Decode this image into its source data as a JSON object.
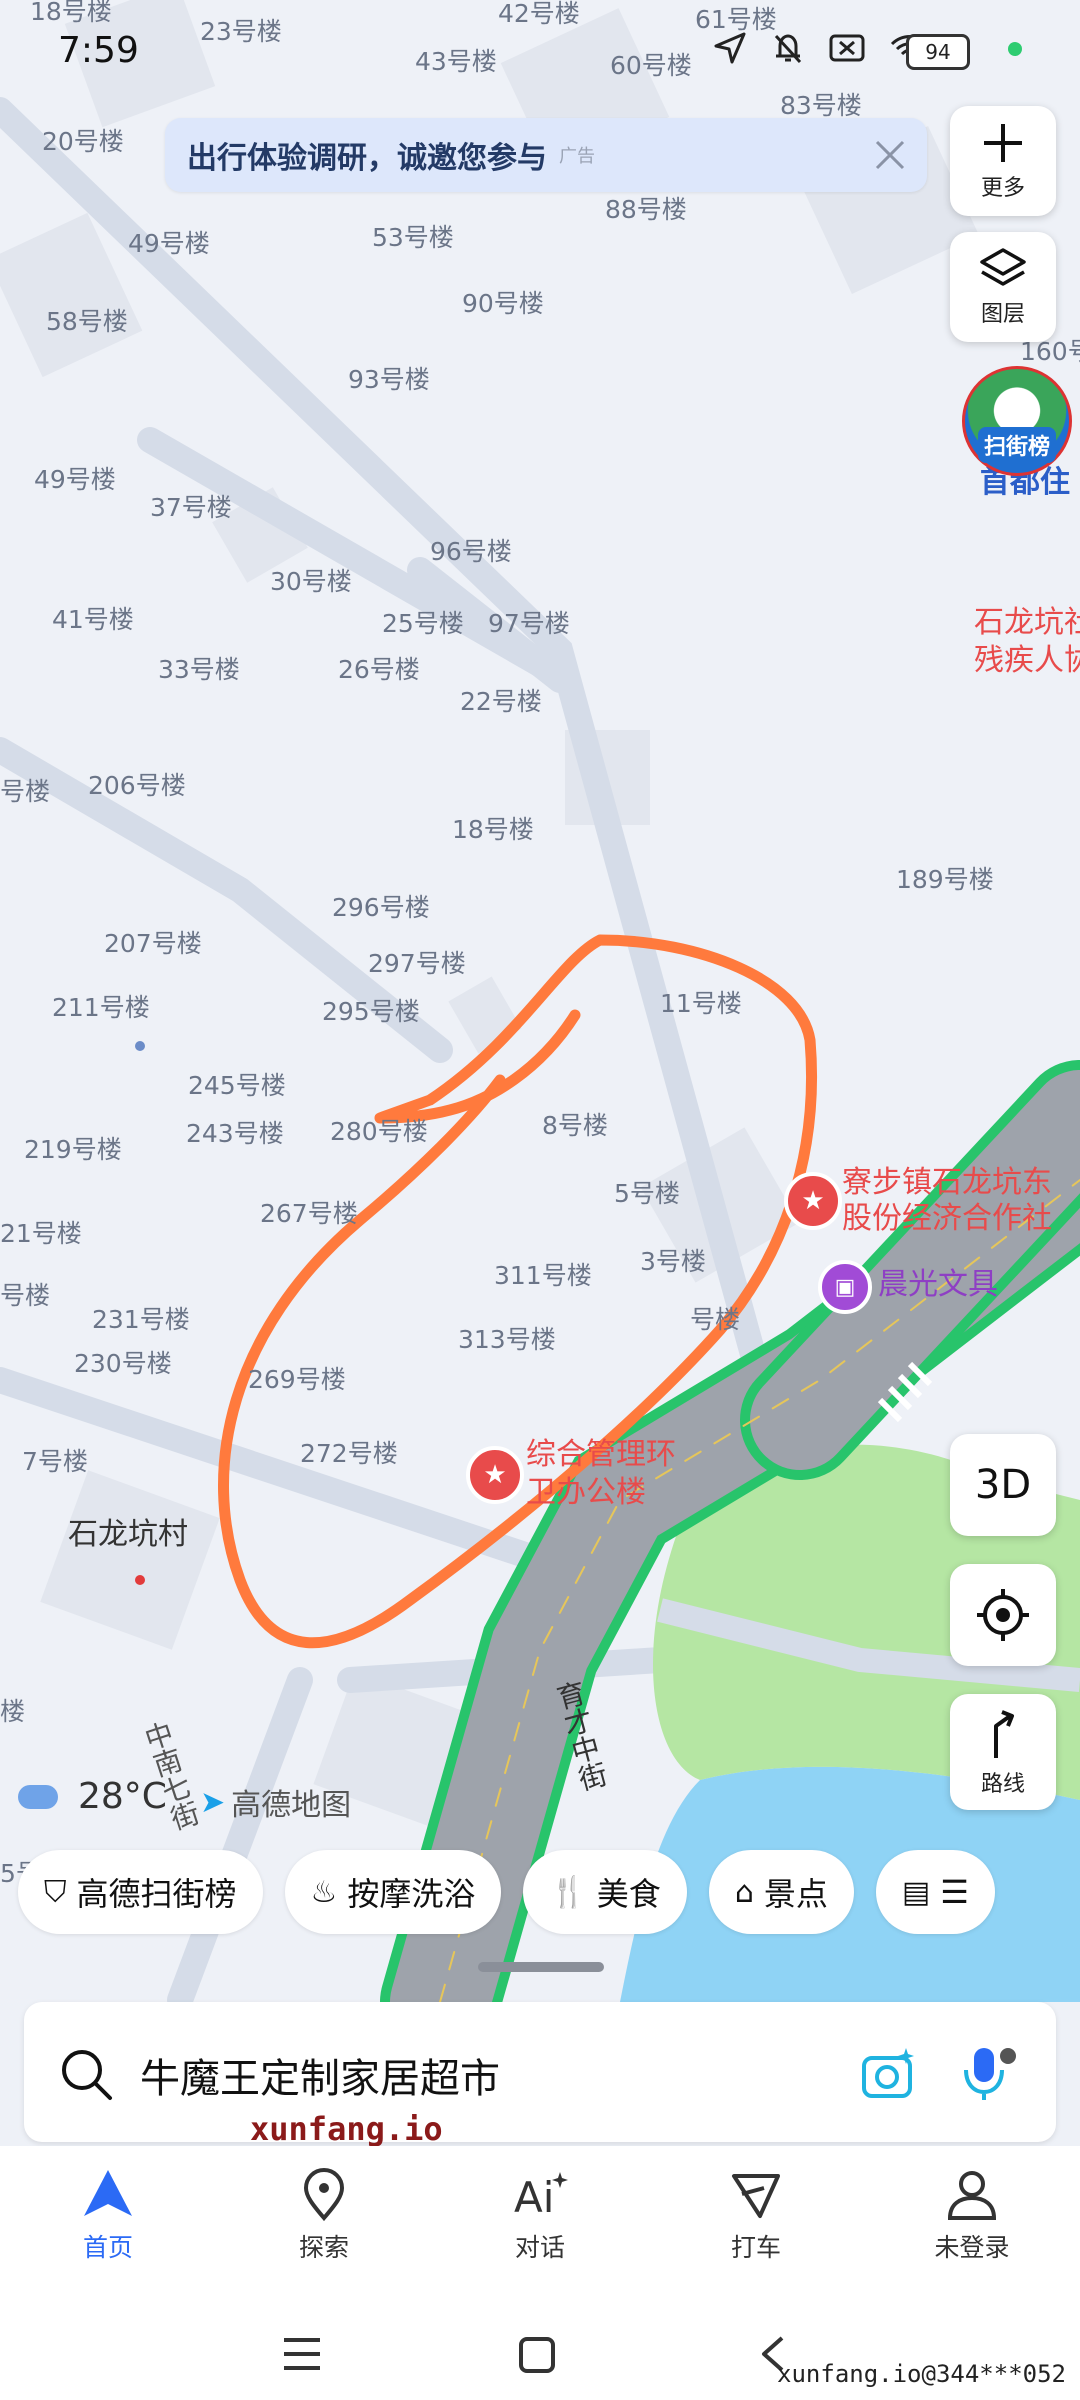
{
  "status_bar": {
    "time": "7:59",
    "battery": "94"
  },
  "banner": {
    "text": "出行体验调研，诚邀您参与",
    "ad_label": "广告"
  },
  "right_controls": {
    "more_label": "更多",
    "layers_label": "图层",
    "scan_badge": "扫街榜",
    "three_d": "3D",
    "route_label": "路线"
  },
  "map": {
    "building_labels": [
      "18号楼",
      "23号楼",
      "42号楼",
      "61号楼",
      "43号楼",
      "60号楼",
      "83号楼",
      "20号楼",
      "88号楼",
      "49号楼",
      "53号楼",
      "58号楼",
      "90号楼",
      "93号楼",
      "160号",
      "49号楼",
      "37号楼",
      "96号楼",
      "30号楼",
      "41号楼",
      "25号楼",
      "97号楼",
      "33号楼",
      "26号楼",
      "22号楼",
      "号楼",
      "206号楼",
      "18号楼",
      "189号楼",
      "296号楼",
      "207号楼",
      "297号楼",
      "211号楼",
      "295号楼",
      "11号楼",
      "245号楼",
      "243号楼",
      "280号楼",
      "8号楼",
      "219号楼",
      "267号楼",
      "5号楼",
      "21号楼",
      "3号楼",
      "311号楼",
      "号楼",
      "231号楼",
      "号楼",
      "313号楼",
      "230号楼",
      "269号楼",
      "272号楼",
      "7号楼",
      "楼",
      "5号"
    ],
    "road_labels": {
      "yucai": "育才中街",
      "zhongnan": "中南七街"
    },
    "pois": {
      "shoudu": "首都住",
      "shilongkeng_disabled_1": "石龙坑社",
      "shilongkeng_disabled_2": "残疾人协",
      "coop_1": "寮步镇石龙坑东",
      "coop_2": "股份经济合作社",
      "stationery": "晨光文具",
      "office_1": "综合管理环",
      "office_2": "卫办公楼",
      "village": "石龙坑村"
    },
    "weather": "28°C",
    "logo": "高德地图"
  },
  "chips": [
    "高德扫街榜",
    "按摩洗浴",
    "美食",
    "景点"
  ],
  "search": {
    "value": "牛魔王定制家居超市"
  },
  "watermark_top": "xunfang.io",
  "nav": [
    "首页",
    "探索",
    "对话",
    "打车",
    "未登录"
  ],
  "watermark_bottom": "xunfang.io@344***052",
  "colors": {
    "accent": "#2b6af5",
    "road_green": "#28c46b",
    "water": "#8fd3f5",
    "park": "#b5e6a3",
    "annotation": "#ff7a3d"
  }
}
